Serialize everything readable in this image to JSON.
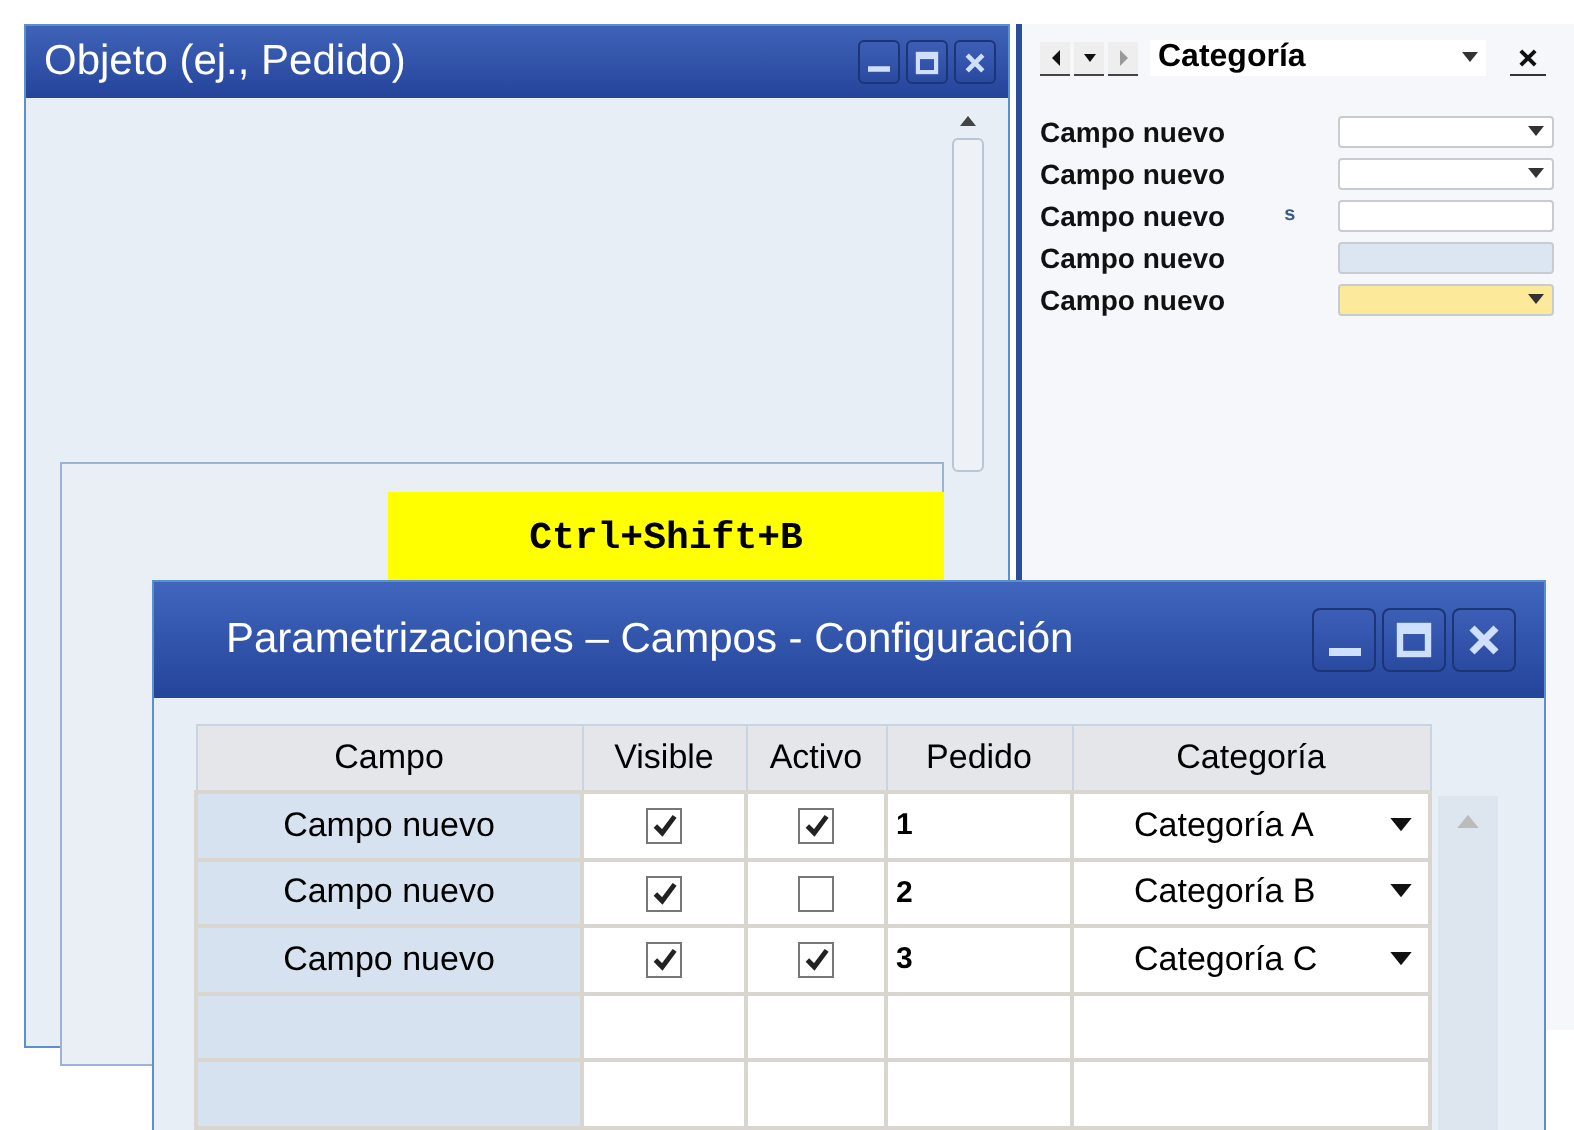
{
  "object_window": {
    "title": "Objeto (ej., Pedido)",
    "shortcut": "Ctrl+Shift+B"
  },
  "side_panel": {
    "title": "Categoría",
    "fields": [
      {
        "label": "Campo nuevo",
        "kind": "dropdown",
        "highlighted": false
      },
      {
        "label": "Campo nuevo",
        "kind": "dropdown",
        "highlighted": false
      },
      {
        "label": "Campo nuevo",
        "kind": "text",
        "highlighted": false,
        "prefix": "s"
      },
      {
        "label": "Campo nuevo",
        "kind": "readonly",
        "highlighted": false
      },
      {
        "label": "Campo nuevo",
        "kind": "dropdown",
        "highlighted": true
      }
    ]
  },
  "settings_window": {
    "title": "Parametrizaciones – Campos - Configuración",
    "table": {
      "columns": [
        "Campo",
        "Visible",
        "Activo",
        "Pedido",
        "Categoría"
      ],
      "rows": [
        {
          "campo": "Campo nuevo",
          "visible": true,
          "active": true,
          "order": "1",
          "category": "Categoría A"
        },
        {
          "campo": "Campo nuevo",
          "visible": true,
          "active": false,
          "order": "2",
          "category": "Categoría B"
        },
        {
          "campo": "Campo nuevo",
          "visible": true,
          "active": true,
          "order": "3",
          "category": "Categoría C"
        }
      ]
    }
  }
}
